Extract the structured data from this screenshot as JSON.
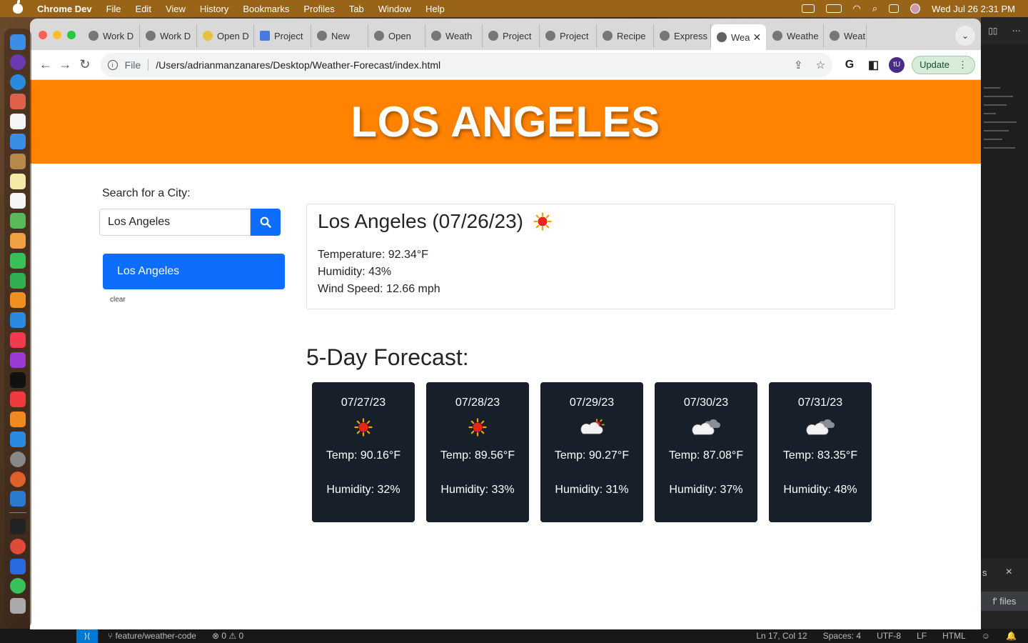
{
  "menubar": {
    "app_name": "Chrome Dev",
    "items": [
      "File",
      "Edit",
      "View",
      "History",
      "Bookmarks",
      "Profiles",
      "Tab",
      "Window",
      "Help"
    ],
    "datetime": "Wed Jul 26  2:31 PM"
  },
  "browser": {
    "tabs": [
      {
        "label": "Work D"
      },
      {
        "label": "Work D"
      },
      {
        "label": "Open D"
      },
      {
        "label": "Project"
      },
      {
        "label": "New"
      },
      {
        "label": "Open"
      },
      {
        "label": "Weath"
      },
      {
        "label": "Project"
      },
      {
        "label": "Project"
      },
      {
        "label": "Recipe"
      },
      {
        "label": "Express"
      },
      {
        "label": "Wea",
        "active": true
      },
      {
        "label": "Weathe"
      },
      {
        "label": "Weat"
      }
    ],
    "address": {
      "scheme_label": "File",
      "path": "/Users/adrianmanzanares/Desktop/Weather-Forecast/index.html"
    },
    "profile_initials": "tU",
    "update_label": "Update"
  },
  "page": {
    "city_heading": "LOS ANGELES",
    "search_label": "Search for a City:",
    "search_value": "Los Angeles",
    "history_items": [
      "Los Angeles"
    ],
    "clear_label": "clear",
    "current": {
      "title": "Los Angeles (07/26/23)",
      "icon": "sun-icon",
      "temperature": "Temperature: 92.34°F",
      "humidity": "Humidity: 43%",
      "wind": "Wind Speed: 12.66 mph"
    },
    "forecast_title": "5-Day Forecast:",
    "forecast": [
      {
        "date": "07/27/23",
        "icon": "sun-icon",
        "temp": "Temp: 90.16°F",
        "humidity": "Humidity: 32%"
      },
      {
        "date": "07/28/23",
        "icon": "sun-icon",
        "temp": "Temp: 89.56°F",
        "humidity": "Humidity: 33%"
      },
      {
        "date": "07/29/23",
        "icon": "sun-behind-cloud-icon",
        "temp": "Temp: 90.27°F",
        "humidity": "Humidity: 31%"
      },
      {
        "date": "07/30/23",
        "icon": "cloud-icon",
        "temp": "Temp: 87.08°F",
        "humidity": "Humidity: 37%"
      },
      {
        "date": "07/31/23",
        "icon": "cloud-icon",
        "temp": "Temp: 83.35°F",
        "humidity": "Humidity: 48%"
      }
    ]
  },
  "editor": {
    "notification_text": "s",
    "notification_action": "f' files"
  },
  "statusbar": {
    "branch": "feature/weather-code",
    "problems": "0 ⚠ 0",
    "position": "Ln 17, Col 12",
    "spaces": "Spaces: 4",
    "encoding": "UTF-8",
    "eol": "LF",
    "language": "HTML"
  },
  "colors": {
    "hero": "#ff8200",
    "primary": "#0d6efd",
    "card_dark": "#17202a"
  }
}
